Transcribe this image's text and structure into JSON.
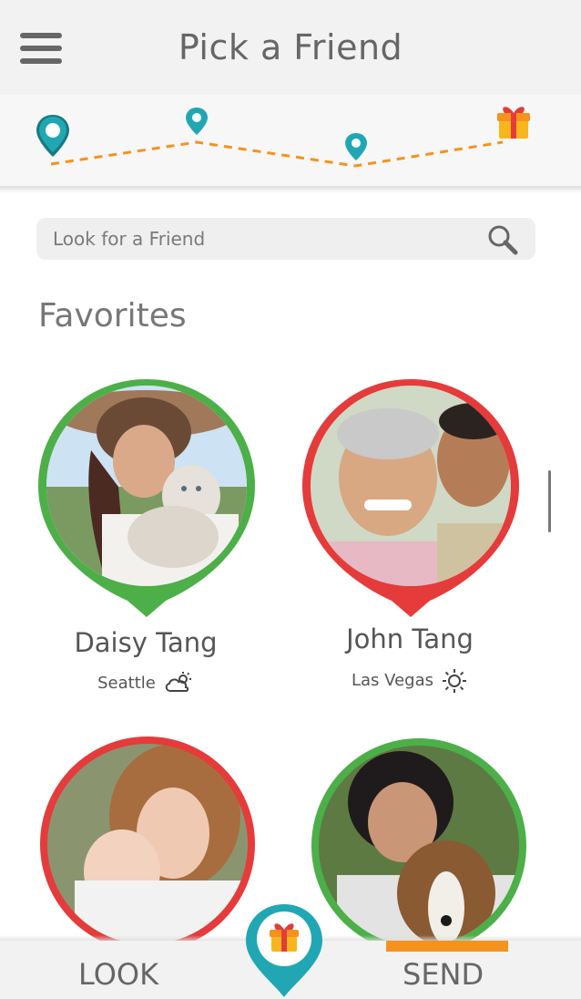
{
  "header": {
    "title": "Pick a Friend",
    "menu_icon": "hamburger-menu-icon"
  },
  "progress": {
    "steps": [
      {
        "icon": "location-pin-icon",
        "state": "current"
      },
      {
        "icon": "location-pin-icon",
        "state": "pending"
      },
      {
        "icon": "location-pin-icon",
        "state": "pending"
      },
      {
        "icon": "gift-icon",
        "state": "goal"
      }
    ],
    "colors": {
      "pin": "#21a7b4",
      "pin_dark": "#167a82",
      "path": "#f5921e"
    }
  },
  "search": {
    "placeholder": "Look for a Friend",
    "value": "",
    "icon": "magnifier-icon"
  },
  "favorites": {
    "title": "Favorites",
    "friends": [
      {
        "name": "Daisy Tang",
        "city": "Seattle",
        "weather_icon": "partly-cloudy-icon",
        "ring_color": "#4caf48",
        "avatar": "woman-with-cat-photo"
      },
      {
        "name": "John Tang",
        "city": "Las Vegas",
        "weather_icon": "sunny-icon",
        "ring_color": "#e53b3b",
        "avatar": "father-and-son-photo"
      },
      {
        "name": "",
        "city": "",
        "weather_icon": "",
        "ring_color": "#e53b3b",
        "avatar": "mother-and-baby-photo"
      },
      {
        "name": "",
        "city": "",
        "weather_icon": "",
        "ring_color": "#4caf48",
        "avatar": "woman-with-dog-photo"
      }
    ]
  },
  "bottom_nav": {
    "left_label": "LOOK",
    "right_label": "SEND",
    "active": "SEND",
    "center_icon": "gift-pin-icon",
    "accent": "#f5921e"
  }
}
